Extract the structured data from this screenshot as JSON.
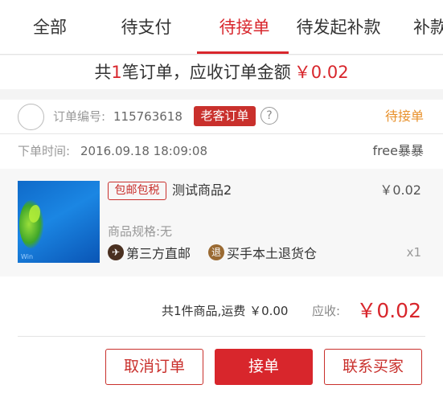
{
  "tabs": [
    {
      "label": "全部"
    },
    {
      "label": "待支付"
    },
    {
      "label": "待接单",
      "active": true
    },
    {
      "label": "待发起补款"
    },
    {
      "label": "补款"
    }
  ],
  "summary": {
    "prefix": "共",
    "count": "1",
    "middle": "笔订单，应收订单金额",
    "amount": "￥0.02"
  },
  "order": {
    "number_label": "订单编号:",
    "number": "115763618",
    "badge": "老客订单",
    "help_glyph": "?",
    "status": "待接单",
    "time_label": "下单时间:",
    "time": "2016.09.18 18:09:08",
    "buyer": "free暴暴"
  },
  "product": {
    "tag": "包邮包税",
    "name": "测试商品2",
    "price": "￥0.02",
    "spec": "商品规格:无",
    "shipping1_icon": "✈",
    "shipping1": "第三方直邮",
    "shipping2_icon": "退",
    "shipping2": "买手本土退货仓",
    "qty": "x1",
    "thumb_watermark": "Win"
  },
  "totals": {
    "text": "共1件商品,运费 ￥0.00",
    "label": "应收:",
    "amount": "￥0.02"
  },
  "buttons": {
    "cancel": "取消订单",
    "accept": "接单",
    "contact": "联系买家"
  },
  "colors": {
    "accent": "#d8262c",
    "status": "#e8912c"
  }
}
